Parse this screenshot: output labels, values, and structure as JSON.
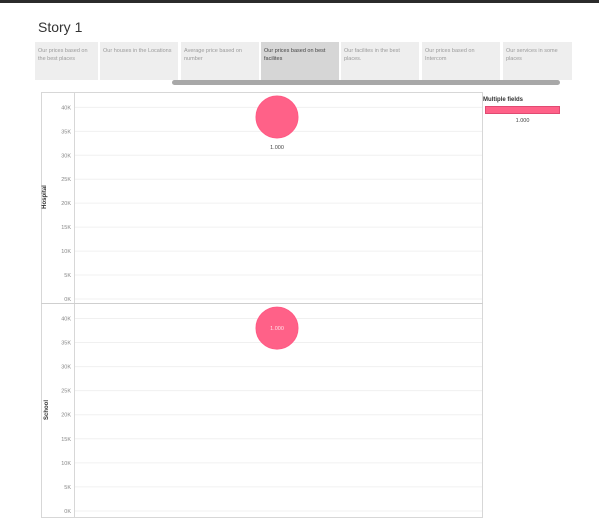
{
  "story": {
    "title": "Story 1"
  },
  "tabs": [
    {
      "label": "Our prices based on the best places",
      "active": false
    },
    {
      "label": "Our houses in the Locations",
      "active": false
    },
    {
      "label": "Average price based on number",
      "active": false
    },
    {
      "label": "Our prices based on best facilites",
      "active": true
    },
    {
      "label": "Our facilites in the best places.",
      "active": false
    },
    {
      "label": "Our prices based on Intercom",
      "active": false
    },
    {
      "label": "Our services in some places",
      "active": false
    }
  ],
  "legend": {
    "title": "Multiple fields",
    "value_label": "1.000"
  },
  "colors": {
    "mark": "#ff6188",
    "mark_stroke": "#ff5a84"
  },
  "chart_data": {
    "type": "scatter",
    "rows": [
      {
        "name": "Hospital",
        "y": 38000,
        "label": "1.000",
        "label_position": "below"
      },
      {
        "name": "School",
        "y": 38000,
        "label": "1.000",
        "label_position": "inside"
      }
    ],
    "ylim": [
      0,
      43000
    ],
    "yticks": [
      0,
      5000,
      10000,
      15000,
      20000,
      25000,
      30000,
      35000,
      40000
    ],
    "ytick_labels": [
      "0K",
      "5K",
      "10K",
      "15K",
      "20K",
      "25K",
      "30K",
      "35K",
      "40K"
    ],
    "grid": true
  }
}
